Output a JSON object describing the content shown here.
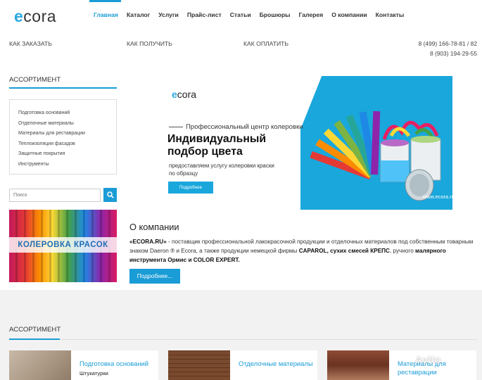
{
  "header": {
    "logo_mark": "e",
    "logo_rest": "cora",
    "nav": [
      "Главная",
      "Каталог",
      "Услуги",
      "Прайс-лист",
      "Статьи",
      "Брошюры",
      "Галерея",
      "О компании",
      "Контакты"
    ],
    "active_nav": "Главная",
    "links": {
      "how_to_order": "КАК ЗАКАЗАТЬ",
      "how_to_receive": "КАК ПОЛУЧИТЬ",
      "how_to_pay": "КАК ОПЛАТИТЬ"
    },
    "phone1": "8 (499) 166-78-81 / 82",
    "phone2": "8 (903) 194-29-55"
  },
  "sidebar": {
    "title": "АССОРТИМЕНТ",
    "categories": [
      "Подготовка оснований",
      "Отделочные материалы",
      "Материалы для реставрации",
      "Теплоизоляция фасадов",
      "Защитные покрытия",
      "Инструменты"
    ],
    "search_placeholder": "Поиск",
    "promo_text": "КОЛЕРОВКА КРАСОК"
  },
  "hero": {
    "logo_mark": "e",
    "logo_rest": "cora",
    "subtitle": "Профессиональный центр колеровки",
    "title_line1": "Индивидуальный",
    "title_line2": "подбор цвета",
    "desc": "предоставляем услугу колеровки краски по образцу",
    "button": "Подробнее",
    "url": "www.ecora.ru"
  },
  "about": {
    "title": "О компании",
    "t1": "«ECORA.RU»",
    "t2": " - поставщик профессиональной лакокрасочной продукции и отделочных материалов под собственным товарным знаком Daeron ® и Ecora, а также продукции немецкой фирмы ",
    "t3": "CAPAROL, сухих смесей КРЕПС",
    "t4": ", ручного ",
    "t5": "малярного инструмента Ормис и COLOR EXPERT.",
    "button": "Подробнее..."
  },
  "assortment": {
    "title": "АССОРТИМЕНТ",
    "cards": [
      {
        "title": "Подготовка оснований",
        "sub": "Штукатурки"
      },
      {
        "title": "Отделочные материалы",
        "sub": ""
      },
      {
        "title": "Материалы для реставрации",
        "sub": ""
      }
    ]
  },
  "watermark": "Avito",
  "colors": {
    "accent": "#1a9cd6",
    "hero_bg": "#1aa7dc"
  }
}
